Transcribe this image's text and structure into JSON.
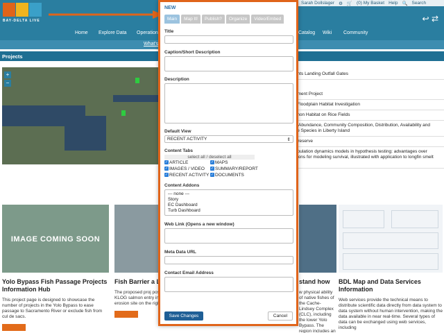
{
  "header": {
    "brand": "BAY-DELTA LIVE",
    "user": "Sarah Dollslager",
    "basket": "(0) My Basket",
    "help": "Help",
    "search": "Search",
    "nav": [
      "Home",
      "Explore Data",
      "Operations",
      "Catalog",
      "Wiki",
      "Community"
    ],
    "subnav": "What's"
  },
  "projects_bar": "Projects",
  "list_items": [
    "ghts Landing Outfall Gates",
    "ement Project",
    "l Floodplain Habitat Investigation",
    "lmon Habitat on Rice Fields",
    "e Abundance, Community Composition, Distribution, Availability and\nve Species in Liberty Island",
    "Preserve",
    "opulation dynamics models in hypothesis testing: advantages over\nsions for modeling survival, illustrated with application to longfin smelt\n)"
  ],
  "cards": [
    {
      "title": "Yolo Bypass Fish Passage Projects Information Hub",
      "text": "This project page is designed to showcase the number of projects in the Yolo Bypass to ease passage to Sacramento River or exclude fish from cul de sacs.",
      "image_text": "IMAGE COMING SOON"
    },
    {
      "title": "Fish Barrier a Landing Outf",
      "text": "The proposed proj positive fish barri the existing KLOG salmon entry into as well as repairing an erosion site on the right..."
    },
    {
      "title": "stand how",
      "text": "w physical ability of native fishes of the Cache-Lindsey Complex (CLC), including the lower Yolo Bypass. The region includes an"
    },
    {
      "title": "BDL Map and Data Services Information",
      "text": "Web services provide the technical means to distribute scientific data directly from data system to data system without human intervention, making the data available in near real-time. Several types of data can be exchanged using web services, including"
    }
  ],
  "modal": {
    "title": "NEW",
    "tabs": [
      "Main",
      "Map It!",
      "Publish?",
      "Organize",
      "Video/Embed"
    ],
    "fields": {
      "title": "Title",
      "caption": "Caption/Short Description",
      "description": "Description",
      "default_view": "Default View",
      "default_view_value": "RECENT ACTIVITY",
      "content_tabs": "Content Tabs",
      "select_all": "select all / deselect all",
      "addons_label": "Content Addons",
      "web_link": "Web Link (Opens a new window)",
      "meta_url": "Meta Data URL",
      "contact_email": "Contact Email Address"
    },
    "checkboxes": [
      "ARTICLE",
      "MAPS",
      "IMAGES / VIDEO",
      "SUMMARY/REPORT",
      "RECENT ACTIVITY",
      "DOCUMENTS"
    ],
    "addons": [
      "--- none ---",
      "Story",
      "EC Dashboard",
      "Turb Dashboard"
    ],
    "save": "Save Changes",
    "cancel": "Cancel"
  }
}
